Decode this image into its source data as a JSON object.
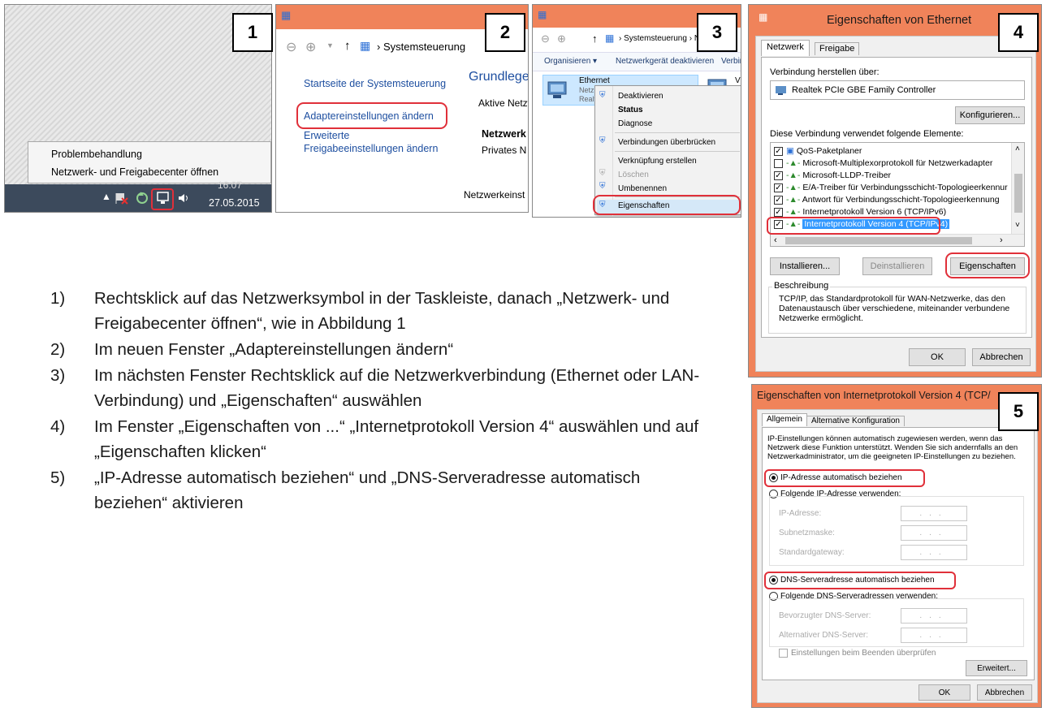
{
  "panel1": {
    "number": "1",
    "menu": [
      "Problembehandlung",
      "Netzwerk- und Freigabecenter öffnen"
    ],
    "clock_time": "16:07",
    "clock_date": "27.05.2015"
  },
  "panel2": {
    "number": "2",
    "breadcrumb": "Systemsteuerung",
    "links": [
      "Startseite der Systemsteuerung",
      "Adaptereinstellungen ändern",
      "Erweiterte",
      "Freigabeeinstellungen ändern"
    ],
    "heading": "Grundlege",
    "active": "Aktive Netzw",
    "net_title": "Netzwerk",
    "net_type": "Privates N",
    "net_settings": "Netzwerkeinst"
  },
  "panel3": {
    "number": "3",
    "breadcrumb": "Systemsteuerung",
    "toolbar": [
      "Organisieren",
      "Netzwerkgerät deaktivieren",
      "Verbin"
    ],
    "adapter_name": "Ethernet",
    "adapter_sub1": "Netz",
    "adapter_sub2": "Realt",
    "other_adapter": "V",
    "context_menu": [
      "Deaktivieren",
      "Status",
      "Diagnose",
      "Verbindungen überbrücken",
      "Verknüpfung erstellen",
      "Löschen",
      "Umbenennen",
      "Eigenschaften"
    ]
  },
  "panel4": {
    "number": "4",
    "title": "Eigenschaften von Ethernet",
    "tabs": [
      "Netzwerk",
      "Freigabe"
    ],
    "connect_label": "Verbindung herstellen über:",
    "adapter": "Realtek PCIe GBE Family Controller",
    "configure": "Konfigurieren...",
    "items_label": "Diese Verbindung verwendet folgende Elemente:",
    "items": [
      {
        "label": "QoS-Paketplaner",
        "checked": true
      },
      {
        "label": "Microsoft-Multiplexorprotokoll für Netzwerkadapter",
        "checked": false
      },
      {
        "label": "Microsoft-LLDP-Treiber",
        "checked": true
      },
      {
        "label": "E/A-Treiber für Verbindungsschicht-Topologieerkennur",
        "checked": true
      },
      {
        "label": "Antwort für Verbindungsschicht-Topologieerkennung",
        "checked": true
      },
      {
        "label": "Internetprotokoll Version 6 (TCP/IPv6)",
        "checked": true
      },
      {
        "label": "Internetprotokoll Version 4 (TCP/IPv4)",
        "checked": true
      }
    ],
    "install": "Installieren...",
    "uninstall": "Deinstallieren",
    "properties": "Eigenschaften",
    "desc_title": "Beschreibung",
    "desc_text": "TCP/IP, das Standardprotokoll für WAN-Netzwerke, das den Datenaustausch über verschiedene, miteinander verbundene Netzwerke ermöglicht.",
    "ok": "OK",
    "cancel": "Abbrechen"
  },
  "panel5": {
    "number": "5",
    "title": "Eigenschaften von Internetprotokoll Version 4 (TCP/",
    "tabs": [
      "Allgemein",
      "Alternative Konfiguration"
    ],
    "intro": "IP-Einstellungen können automatisch zugewiesen werden, wenn das Netzwerk diese Funktion unterstützt. Wenden Sie sich andernfalls an den Netzwerkadministrator, um die geeigneten IP-Einstellungen zu beziehen.",
    "ip_auto": "IP-Adresse automatisch beziehen",
    "ip_manual": "Folgende IP-Adresse verwenden:",
    "ip_fields": [
      "IP-Adresse:",
      "Subnetzmaske:",
      "Standardgateway:"
    ],
    "dns_auto": "DNS-Serveradresse automatisch beziehen",
    "dns_manual": "Folgende DNS-Serveradressen verwenden:",
    "dns_fields": [
      "Bevorzugter DNS-Server:",
      "Alternativer DNS-Server:"
    ],
    "validate": "Einstellungen beim Beenden überprüfen",
    "advanced": "Erweitert...",
    "ok": "OK",
    "cancel": "Abbrechen"
  },
  "steps": [
    {
      "n": "1)",
      "text": "Rechtsklick auf das Netzwerksymbol in der Taskleiste, danach „Netzwerk- und Freigabecenter öffnen“, wie in Abbildung 1"
    },
    {
      "n": "2)",
      "text": "Im neuen Fenster „Adaptereinstellungen ändern“"
    },
    {
      "n": "3)",
      "text": "Im nächsten Fenster Rechtsklick auf die Netzwerkverbindung (Ethernet oder LAN-Verbindung) und „Eigenschaften“ auswählen"
    },
    {
      "n": "4)",
      "text": "Im Fenster „Eigenschaften von ...“ „Internetprotokoll Version 4“ auswählen und auf „Eigenschaften klicken“"
    },
    {
      "n": "5)",
      "text": "„IP-Adresse automatisch beziehen“ und „DNS-Serveradresse automatisch beziehen“ aktivieren"
    }
  ],
  "colors": {
    "frame_orange": "#f0835a",
    "highlight_red": "#e0303a",
    "link_blue": "#1e4fa0",
    "select_blue": "#3399ff"
  }
}
